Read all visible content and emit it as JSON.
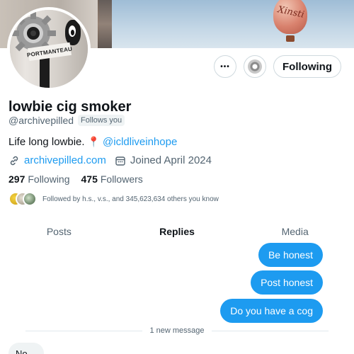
{
  "banner": {
    "balloon_text": "Xinsti"
  },
  "avatar": {
    "sign_text": "PORTMANTEAU"
  },
  "profile": {
    "name": "lowbie cig smoker",
    "handle": "@archivepilled",
    "follows_you": "Follows you",
    "bio_text": "Life long lowbie.",
    "bio_mention": "@icldliveinhope",
    "website": "archivepilled.com",
    "joined": "Joined April 2024",
    "following_count": "297",
    "following_label": "Following",
    "followers_count": "475",
    "followers_label": "Followers",
    "followed_by": "Followed by h.s., v.s., and 345,623,634 others you know"
  },
  "actions": {
    "more": "•••",
    "following_button": "Following"
  },
  "tabs": [
    {
      "label": "Posts",
      "active": false
    },
    {
      "label": "Replies",
      "active": true
    },
    {
      "label": "Media",
      "active": false
    }
  ],
  "messages": {
    "bubble1": "Be honest",
    "bubble2": "Post honest",
    "bubble3": "Do you have a cog",
    "new_message": "1 new message",
    "incoming": "No"
  },
  "colors": {
    "accent": "#1d9bf0",
    "text": "#0f1419",
    "muted": "#536471"
  },
  "icons": [
    "more-icon",
    "notify-icon",
    "link-icon",
    "calendar-icon",
    "pin-icon"
  ]
}
